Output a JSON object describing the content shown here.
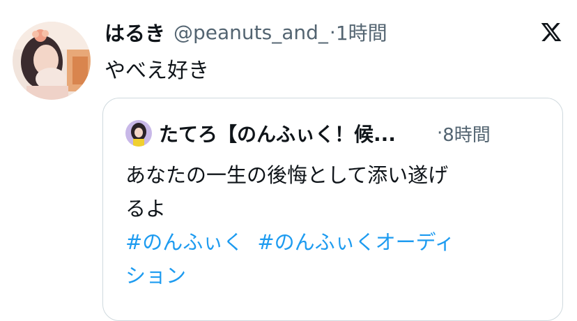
{
  "tweet": {
    "display_name": "はるき",
    "handle": "@peanuts_and_",
    "separator": "·",
    "time": "1時間",
    "text": "やべえ好き",
    "platform_icon": "x-logo-icon",
    "avatar_icon": "user-avatar-photo"
  },
  "quote": {
    "display_name": "たてろ【のんふぃく！候...",
    "separator": "·",
    "time": "8時間",
    "text_line1": "あなたの一生の後悔として添い遂げ",
    "text_line2": "るよ",
    "hashtag1": "#のんふぃく",
    "hashtag2_line1": "#のんふぃくオーディ",
    "hashtag2_line2": "ション",
    "avatar_icon": "quoted-user-avatar-photo"
  },
  "colors": {
    "text": "#0f1419",
    "muted": "#536471",
    "link": "#1d9bf0",
    "border": "#cfd9de"
  }
}
